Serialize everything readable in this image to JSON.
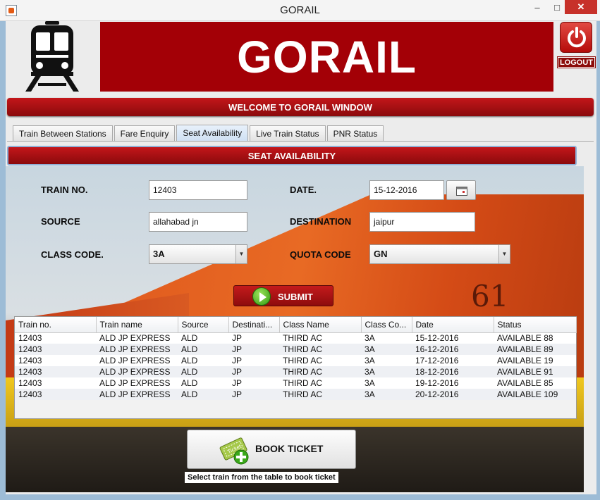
{
  "window": {
    "title": "GORAIL",
    "minimize": "–",
    "maximize": "□",
    "close": "✕"
  },
  "header": {
    "brand": "GORAIL",
    "logout_label": "LOGOUT",
    "welcome": "WELCOME TO GORAIL WINDOW"
  },
  "tabs": [
    {
      "label": "Train Between Stations"
    },
    {
      "label": "Fare Enquiry"
    },
    {
      "label": "Seat Availability"
    },
    {
      "label": "Live Train Status"
    },
    {
      "label": "PNR Status"
    }
  ],
  "active_tab": "Seat Availability",
  "panel_title": "SEAT AVAILABILITY",
  "form": {
    "train_no_label": "TRAIN NO.",
    "train_no_value": "12403",
    "date_label": "DATE.",
    "date_value": "15-12-2016",
    "source_label": "SOURCE",
    "source_value": "allahabad jn",
    "destination_label": "DESTINATION",
    "destination_value": "jaipur",
    "class_code_label": "CLASS CODE.",
    "class_code_value": "3A",
    "quota_code_label": "QUOTA CODE",
    "quota_code_value": "GN",
    "submit_label": "SUBMIT"
  },
  "table": {
    "columns": [
      "Train no.",
      "Train name",
      "Source",
      "Destinati...",
      "Class Name",
      "Class Co...",
      "Date",
      "Status"
    ],
    "rows": [
      [
        "12403",
        "ALD JP EXPRESS",
        "ALD",
        "JP",
        "THIRD AC",
        "3A",
        "15-12-2016",
        "AVAILABLE 88"
      ],
      [
        "12403",
        "ALD JP EXPRESS",
        "ALD",
        "JP",
        "THIRD AC",
        "3A",
        "16-12-2016",
        "AVAILABLE 89"
      ],
      [
        "12403",
        "ALD JP EXPRESS",
        "ALD",
        "JP",
        "THIRD AC",
        "3A",
        "17-12-2016",
        "AVAILABLE 19"
      ],
      [
        "12403",
        "ALD JP EXPRESS",
        "ALD",
        "JP",
        "THIRD AC",
        "3A",
        "18-12-2016",
        "AVAILABLE 91"
      ],
      [
        "12403",
        "ALD JP EXPRESS",
        "ALD",
        "JP",
        "THIRD AC",
        "3A",
        "19-12-2016",
        "AVAILABLE 85"
      ],
      [
        "12403",
        "ALD JP EXPRESS",
        "ALD",
        "JP",
        "THIRD AC",
        "3A",
        "20-12-2016",
        "AVAILABLE 109"
      ]
    ]
  },
  "book": {
    "label": "BOOK TICKET",
    "icon_text": "Ticket",
    "hint": "Select train from the table to book ticket"
  },
  "decor": {
    "loco_number": "61"
  },
  "colors": {
    "brand_red": "#a30006",
    "bar_red": "#c3161a",
    "logout_red": "#d9302b",
    "submit_green": "#2f9a12"
  },
  "icons": {
    "logo": "train-front-icon",
    "logout": "power-icon",
    "date_picker": "calendar-icon",
    "submit": "arrow-right-circle-icon",
    "book": "ticket-add-icon"
  }
}
